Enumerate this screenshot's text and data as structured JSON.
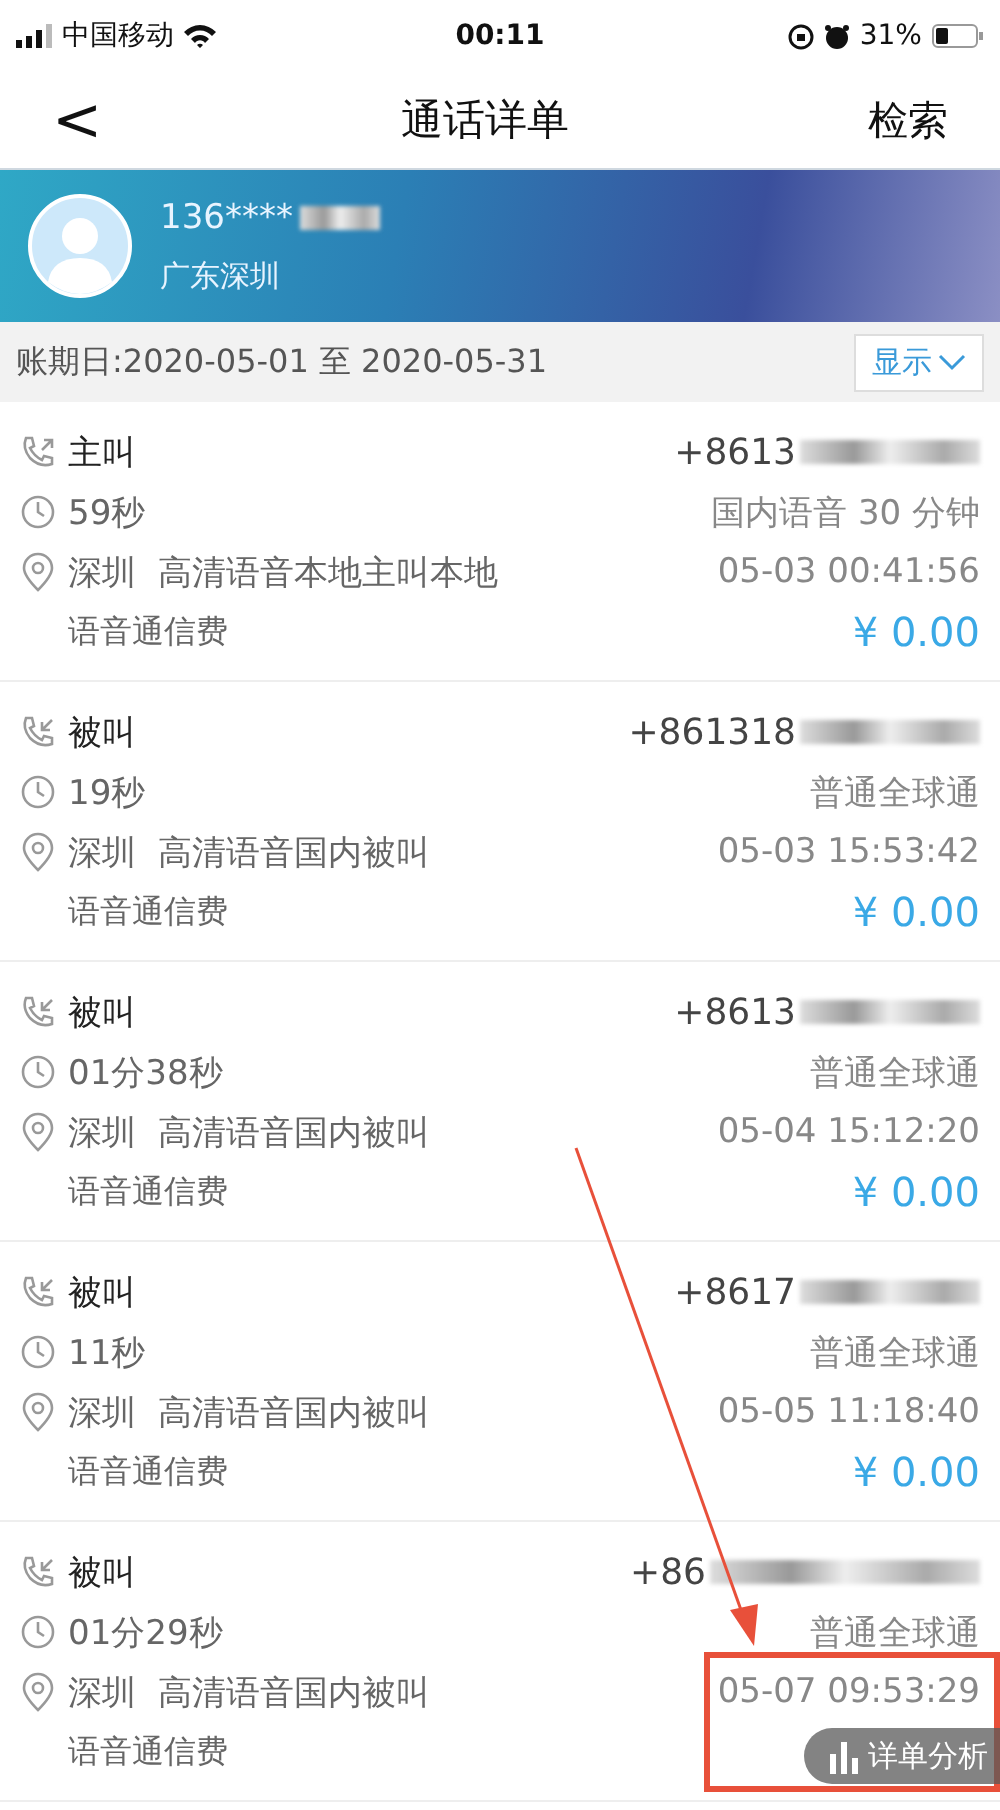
{
  "status_bar": {
    "carrier": "中国移动",
    "time": "00:11",
    "battery": "31%"
  },
  "nav": {
    "back": "<",
    "title": "通话详单",
    "action": "检索"
  },
  "account": {
    "number": "136****",
    "location": "广东深圳"
  },
  "period": {
    "label": "账期日:2020-05-01 至 2020-05-31",
    "toggle": "显示"
  },
  "calls": [
    {
      "kind": "outgoing",
      "type": "主叫",
      "number": "+8613",
      "duration": "59秒",
      "plan": "国内语音 30 分钟",
      "place": "深圳  高清语音本地主叫本地",
      "time": "05-03 00:41:56",
      "fee_type": "语音通信费",
      "amount": "¥ 0.00"
    },
    {
      "kind": "incoming",
      "type": "被叫",
      "number": "+861318",
      "duration": "19秒",
      "plan": "普通全球通",
      "place": "深圳  高清语音国内被叫",
      "time": "05-03 15:53:42",
      "fee_type": "语音通信费",
      "amount": "¥ 0.00"
    },
    {
      "kind": "incoming",
      "type": "被叫",
      "number": "+8613",
      "duration": "01分38秒",
      "plan": "普通全球通",
      "place": "深圳  高清语音国内被叫",
      "time": "05-04 15:12:20",
      "fee_type": "语音通信费",
      "amount": "¥ 0.00"
    },
    {
      "kind": "incoming",
      "type": "被叫",
      "number": "+8617",
      "duration": "11秒",
      "plan": "普通全球通",
      "place": "深圳  高清语音国内被叫",
      "time": "05-05 11:18:40",
      "fee_type": "语音通信费",
      "amount": "¥ 0.00"
    },
    {
      "kind": "incoming",
      "type": "被叫",
      "number": "+86",
      "duration": "01分29秒",
      "plan": "普通全球通",
      "place": "深圳  高清语音国内被叫",
      "time": "05-07 09:53:29",
      "fee_type": "语音通信费"
    }
  ],
  "float_button": {
    "label": "详单分析"
  }
}
